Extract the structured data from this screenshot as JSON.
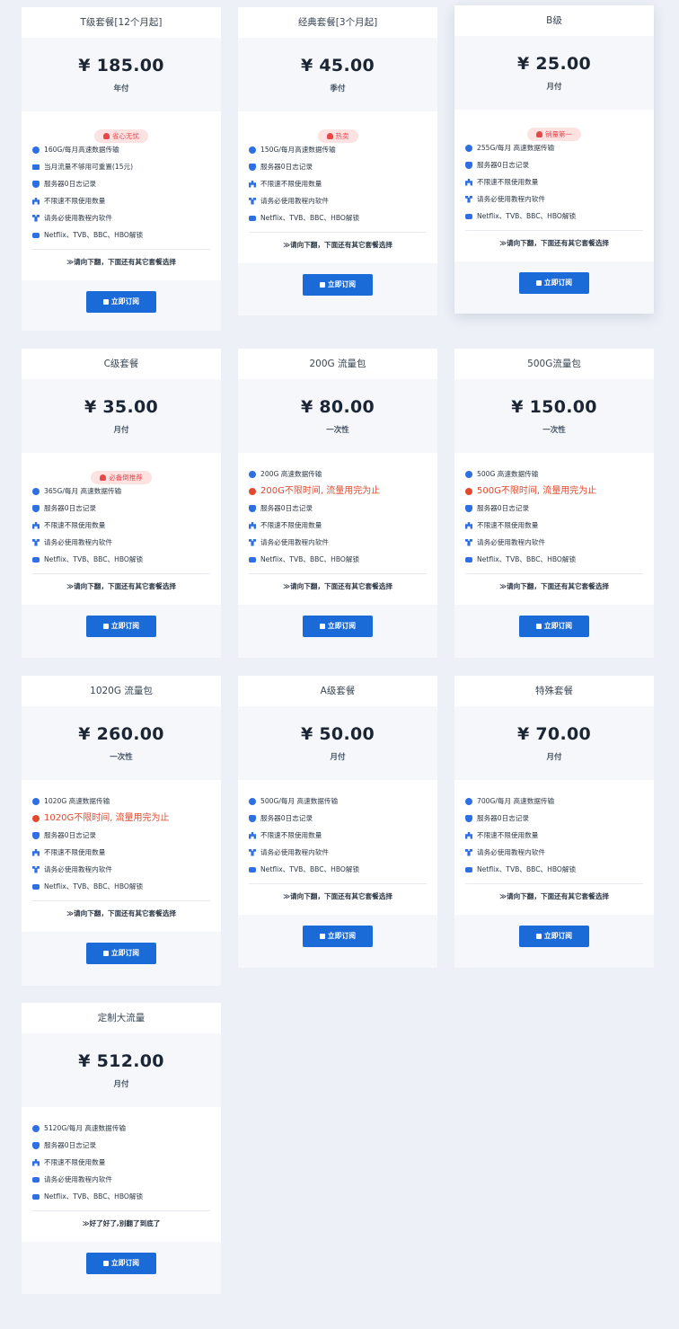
{
  "note_default": "≫请向下翻，下面还有其它套餐选择",
  "btn_label": "立即订阅",
  "plans": [
    {
      "title": "T级套餐[12个月起]",
      "price": "¥ 185.00",
      "period": "年付",
      "badge": "省心无忧",
      "features": [
        {
          "icon": "globe-icon",
          "text": "160G/每月高速数据传输"
        },
        {
          "icon": "card-icon",
          "text": "当月流量不够用可重置(15元)"
        },
        {
          "icon": "shield-icon",
          "text": "服务器0日志记录"
        },
        {
          "icon": "network-icon",
          "text": "不限速不限使用数量"
        },
        {
          "icon": "flow-icon",
          "text": "请务必使用教程内软件"
        },
        {
          "icon": "youtube-icon",
          "text": "Netflix、TVB、BBC、HBO解锁"
        }
      ],
      "note": "≫请向下翻，下面还有其它套餐选择"
    },
    {
      "title": "经典套餐[3个月起]",
      "price": "¥ 45.00",
      "period": "季付",
      "badge": "热卖",
      "features": [
        {
          "icon": "globe-icon",
          "text": "150G/每月高速数据传输"
        },
        {
          "icon": "shield-icon",
          "text": "服务器0日志记录"
        },
        {
          "icon": "network-icon",
          "text": "不限速不限使用数量"
        },
        {
          "icon": "flow-icon",
          "text": "请务必使用教程内软件"
        },
        {
          "icon": "youtube-icon",
          "text": "Netflix、TVB、BBC、HBO解锁"
        }
      ],
      "note": "≫请向下翻，下面还有其它套餐选择"
    },
    {
      "title": "B级",
      "price": "¥ 25.00",
      "period": "月付",
      "badge": "销量第一",
      "features": [
        {
          "icon": "globe-icon",
          "text": "255G/每月 高速数据传输"
        },
        {
          "icon": "shield-icon",
          "text": "服务器0日志记录"
        },
        {
          "icon": "network-icon",
          "text": "不限速不限使用数量"
        },
        {
          "icon": "flow-icon",
          "text": "请务必使用教程内软件"
        },
        {
          "icon": "youtube-icon",
          "text": "Netflix、TVB、BBC、HBO解锁"
        }
      ],
      "note": "≫请向下翻，下面还有其它套餐选择"
    },
    {
      "title": "C级套餐",
      "price": "¥ 35.00",
      "period": "月付",
      "badge": "必备倒推荐",
      "features": [
        {
          "icon": "globe-icon",
          "text": "365G/每月 高速数据传输"
        },
        {
          "icon": "shield-icon",
          "text": "服务器0日志记录"
        },
        {
          "icon": "network-icon",
          "text": "不限速不限使用数量"
        },
        {
          "icon": "flow-icon",
          "text": "请务必使用教程内软件"
        },
        {
          "icon": "youtube-icon",
          "text": "Netflix、TVB、BBC、HBO解锁"
        }
      ],
      "note": "≫请向下翻，下面还有其它套餐选择"
    },
    {
      "title": "200G 流量包",
      "price": "¥ 80.00",
      "period": "一次性",
      "badge": "",
      "features": [
        {
          "icon": "globe-icon",
          "text": "200G 高速数据传输"
        },
        {
          "icon": "download-icon",
          "text": "200G不限时间, 流量用完为止",
          "highlight": true
        },
        {
          "icon": "shield-icon",
          "text": "服务器0日志记录"
        },
        {
          "icon": "network-icon",
          "text": "不限速不限使用数量"
        },
        {
          "icon": "flow-icon",
          "text": "请务必使用教程内软件"
        },
        {
          "icon": "youtube-icon",
          "text": "Netflix、TVB、BBC、HBO解锁"
        }
      ],
      "note": "≫请向下翻，下面还有其它套餐选择"
    },
    {
      "title": "500G流量包",
      "price": "¥ 150.00",
      "period": "一次性",
      "badge": "",
      "features": [
        {
          "icon": "globe-icon",
          "text": "500G 高速数据传输"
        },
        {
          "icon": "download-icon",
          "text": "500G不限时间, 流量用完为止",
          "highlight": true
        },
        {
          "icon": "shield-icon",
          "text": "服务器0日志记录"
        },
        {
          "icon": "network-icon",
          "text": "不限速不限使用数量"
        },
        {
          "icon": "flow-icon",
          "text": "请务必使用教程内软件"
        },
        {
          "icon": "youtube-icon",
          "text": "Netflix、TVB、BBC、HBO解锁"
        }
      ],
      "note": "≫请向下翻，下面还有其它套餐选择"
    },
    {
      "title": "1020G 流量包",
      "price": "¥ 260.00",
      "period": "一次性",
      "badge": "",
      "features": [
        {
          "icon": "globe-icon",
          "text": "1020G 高速数据传输"
        },
        {
          "icon": "download-icon",
          "text": "1020G不限时间, 流量用完为止",
          "highlight": true
        },
        {
          "icon": "shield-icon",
          "text": "服务器0日志记录"
        },
        {
          "icon": "network-icon",
          "text": "不限速不限使用数量"
        },
        {
          "icon": "flow-icon",
          "text": "请务必使用教程内软件"
        },
        {
          "icon": "youtube-icon",
          "text": "Netflix、TVB、BBC、HBO解锁"
        }
      ],
      "note": "≫请向下翻，下面还有其它套餐选择"
    },
    {
      "title": "A级套餐",
      "price": "¥ 50.00",
      "period": "月付",
      "badge": "",
      "features": [
        {
          "icon": "globe-icon",
          "text": "500G/每月 高速数据传输"
        },
        {
          "icon": "shield-icon",
          "text": "服务器0日志记录"
        },
        {
          "icon": "network-icon",
          "text": "不限速不限使用数量"
        },
        {
          "icon": "flow-icon",
          "text": "请务必使用教程内软件"
        },
        {
          "icon": "youtube-icon",
          "text": "Netflix、TVB、BBC、HBO解锁"
        }
      ],
      "note": "≫请向下翻，下面还有其它套餐选择"
    },
    {
      "title": "特殊套餐",
      "price": "¥ 70.00",
      "period": "月付",
      "badge": "",
      "features": [
        {
          "icon": "globe-icon",
          "text": "700G/每月 高速数据传输"
        },
        {
          "icon": "shield-icon",
          "text": "服务器0日志记录"
        },
        {
          "icon": "network-icon",
          "text": "不限速不限使用数量"
        },
        {
          "icon": "flow-icon",
          "text": "请务必使用教程内软件"
        },
        {
          "icon": "youtube-icon",
          "text": "Netflix、TVB、BBC、HBO解锁"
        }
      ],
      "note": "≫请向下翻，下面还有其它套餐选择"
    },
    {
      "title": "定制大流量",
      "price": "¥ 512.00",
      "period": "月付",
      "badge": "",
      "features": [
        {
          "icon": "globe-icon",
          "text": "5120G/每月 高速数据传输"
        },
        {
          "icon": "shield-icon",
          "text": "服务器0日志记录"
        },
        {
          "icon": "network-icon",
          "text": "不限速不限使用数量"
        },
        {
          "icon": "youtube-icon",
          "text": "请务必使用教程内软件"
        },
        {
          "icon": "youtube-icon",
          "text": "Netflix、TVB、BBC、HBO解锁"
        }
      ],
      "note": "≫好了好了,别翻了到底了"
    }
  ],
  "colors": {
    "accent": "#1a6ad8",
    "highlight": "#e14a2f",
    "badge_bg": "#fde2e2",
    "badge_text": "#e8474a",
    "page_bg": "#edf0f6"
  }
}
